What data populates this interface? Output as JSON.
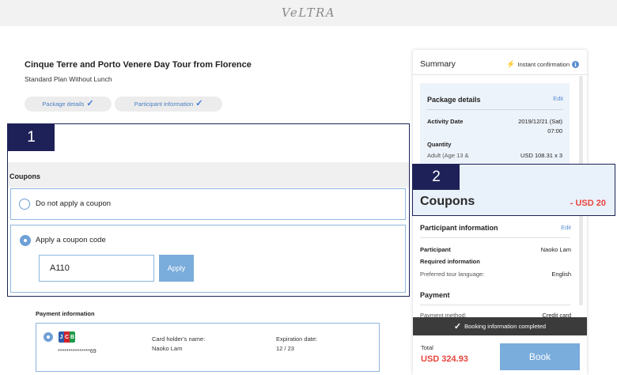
{
  "brand": {
    "logo_text": "VeLTRA"
  },
  "tour": {
    "title": "Cinque Terre and Porto Venere Day Tour from Florence",
    "plan": "Standard Plan Without Lunch"
  },
  "steps": [
    {
      "label": "Package details",
      "done": true
    },
    {
      "label": "Participant information",
      "done": true
    }
  ],
  "callouts": {
    "one": "1",
    "two": "2"
  },
  "coupons": {
    "heading": "Coupons",
    "options": [
      {
        "label": "Do not apply a coupon",
        "selected": false
      },
      {
        "label": "Apply a coupon code",
        "selected": true
      }
    ],
    "code_value": "A110",
    "apply_label": "Apply"
  },
  "payment": {
    "heading": "Payment information",
    "card_number": "***************69",
    "holder_label": "Card holder's name:",
    "holder_value": "Naoko Lam",
    "expiration_label": "Expiration date:",
    "expiration_value": "12 / 23"
  },
  "summary": {
    "title": "Summary",
    "instant": "Instant confirmation",
    "package": {
      "title": "Package details",
      "edit": "Edit",
      "activity_date_label": "Activity Date",
      "activity_date_value": "2019/12/21 (Sat)",
      "activity_time": "07:00",
      "quantity_label": "Quantity",
      "adult_label": "Adult (Age 13 &",
      "adult_value": "USD 108.31 x 3"
    },
    "coupons_label": "Coupons",
    "coupons_value": "- USD 20",
    "participant": {
      "title": "Participant information",
      "edit": "Edit",
      "participant_label": "Participant",
      "participant_value": "Naoko Lam",
      "required_label": "Required information",
      "language_label": "Preferred tour language:",
      "language_value": "English"
    },
    "payment": {
      "title": "Payment",
      "method_label": "Payment method:",
      "method_value": "Credit card"
    },
    "booking_status": "Booking information completed",
    "total_label": "Total",
    "total_value": "USD 324.93",
    "book_label": "Book"
  },
  "colors": {
    "accent_blue": "#7aacdc",
    "navy_callout": "#1e2158",
    "discount_red": "#e8453c"
  }
}
